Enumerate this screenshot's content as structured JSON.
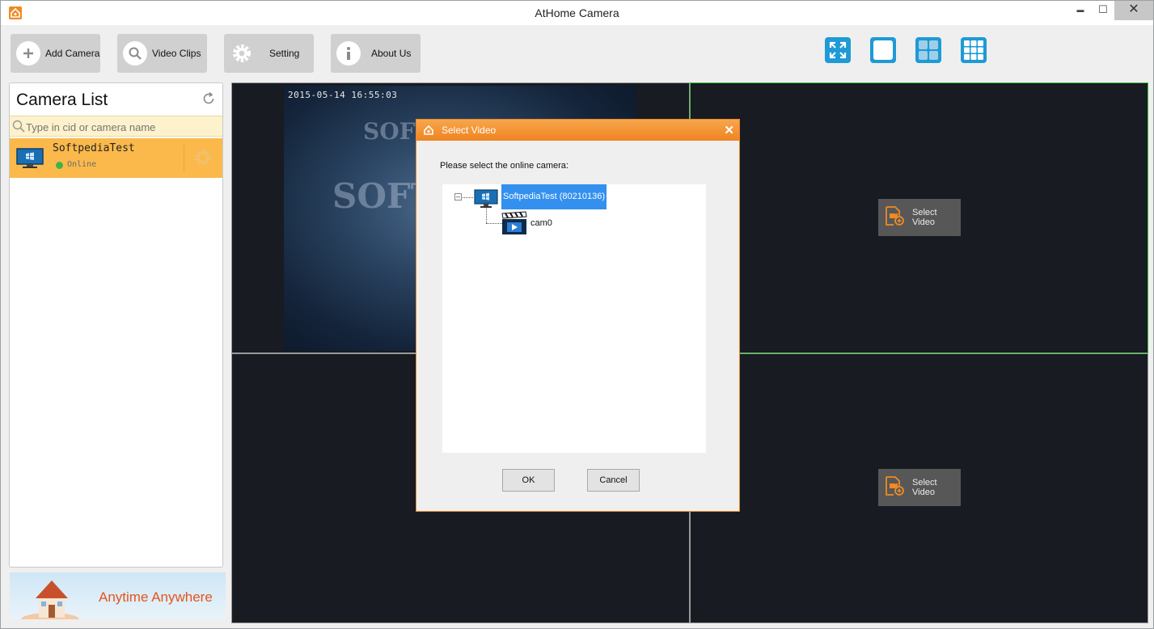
{
  "window": {
    "title": "AtHome Camera",
    "minimize_glyph": "▬",
    "maximize_glyph": "☐",
    "close_glyph": "✕"
  },
  "toolbar": {
    "buttons": [
      {
        "label": "Add Camera",
        "icon": "plus-icon"
      },
      {
        "label": "Video Clips",
        "icon": "search-icon"
      },
      {
        "label": "Setting",
        "icon": "gear-icon"
      },
      {
        "label": "About Us",
        "icon": "info-icon"
      }
    ],
    "view_buttons": [
      "fullscreen-icon",
      "single-view-icon",
      "quad-view-icon",
      "nine-view-icon"
    ],
    "accent_color": "#1e9ad6"
  },
  "camera_list": {
    "title": "Camera List",
    "search_placeholder": "Type in cid or camera name",
    "cameras": [
      {
        "name": "SoftpediaTest",
        "status": "Online",
        "status_color": "#3cb44a"
      }
    ]
  },
  "banner": {
    "text": "Anytime Anywhere"
  },
  "video_grid": {
    "timestamp": "2015-05-14 16:55:03",
    "select_video_label": "Select Video"
  },
  "dialog": {
    "title": "Select Video",
    "prompt": "Please select the online camera:",
    "tree": {
      "device": "SoftpediaTest (80210136)",
      "toggle": "–",
      "child": "cam0"
    },
    "ok_label": "OK",
    "cancel_label": "Cancel",
    "title_color": "#ef8421"
  }
}
